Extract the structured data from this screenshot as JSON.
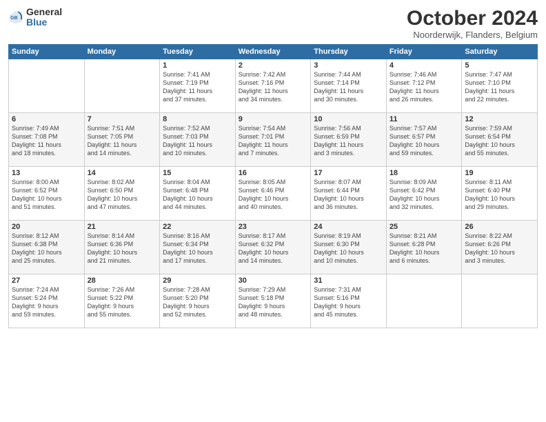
{
  "header": {
    "logo_general": "General",
    "logo_blue": "Blue",
    "month_title": "October 2024",
    "location": "Noorderwijk, Flanders, Belgium"
  },
  "days_of_week": [
    "Sunday",
    "Monday",
    "Tuesday",
    "Wednesday",
    "Thursday",
    "Friday",
    "Saturday"
  ],
  "weeks": [
    [
      {
        "day": "",
        "info": ""
      },
      {
        "day": "",
        "info": ""
      },
      {
        "day": "1",
        "info": "Sunrise: 7:41 AM\nSunset: 7:19 PM\nDaylight: 11 hours\nand 37 minutes."
      },
      {
        "day": "2",
        "info": "Sunrise: 7:42 AM\nSunset: 7:16 PM\nDaylight: 11 hours\nand 34 minutes."
      },
      {
        "day": "3",
        "info": "Sunrise: 7:44 AM\nSunset: 7:14 PM\nDaylight: 11 hours\nand 30 minutes."
      },
      {
        "day": "4",
        "info": "Sunrise: 7:46 AM\nSunset: 7:12 PM\nDaylight: 11 hours\nand 26 minutes."
      },
      {
        "day": "5",
        "info": "Sunrise: 7:47 AM\nSunset: 7:10 PM\nDaylight: 11 hours\nand 22 minutes."
      }
    ],
    [
      {
        "day": "6",
        "info": "Sunrise: 7:49 AM\nSunset: 7:08 PM\nDaylight: 11 hours\nand 18 minutes."
      },
      {
        "day": "7",
        "info": "Sunrise: 7:51 AM\nSunset: 7:05 PM\nDaylight: 11 hours\nand 14 minutes."
      },
      {
        "day": "8",
        "info": "Sunrise: 7:52 AM\nSunset: 7:03 PM\nDaylight: 11 hours\nand 10 minutes."
      },
      {
        "day": "9",
        "info": "Sunrise: 7:54 AM\nSunset: 7:01 PM\nDaylight: 11 hours\nand 7 minutes."
      },
      {
        "day": "10",
        "info": "Sunrise: 7:56 AM\nSunset: 6:59 PM\nDaylight: 11 hours\nand 3 minutes."
      },
      {
        "day": "11",
        "info": "Sunrise: 7:57 AM\nSunset: 6:57 PM\nDaylight: 10 hours\nand 59 minutes."
      },
      {
        "day": "12",
        "info": "Sunrise: 7:59 AM\nSunset: 6:54 PM\nDaylight: 10 hours\nand 55 minutes."
      }
    ],
    [
      {
        "day": "13",
        "info": "Sunrise: 8:00 AM\nSunset: 6:52 PM\nDaylight: 10 hours\nand 51 minutes."
      },
      {
        "day": "14",
        "info": "Sunrise: 8:02 AM\nSunset: 6:50 PM\nDaylight: 10 hours\nand 47 minutes."
      },
      {
        "day": "15",
        "info": "Sunrise: 8:04 AM\nSunset: 6:48 PM\nDaylight: 10 hours\nand 44 minutes."
      },
      {
        "day": "16",
        "info": "Sunrise: 8:05 AM\nSunset: 6:46 PM\nDaylight: 10 hours\nand 40 minutes."
      },
      {
        "day": "17",
        "info": "Sunrise: 8:07 AM\nSunset: 6:44 PM\nDaylight: 10 hours\nand 36 minutes."
      },
      {
        "day": "18",
        "info": "Sunrise: 8:09 AM\nSunset: 6:42 PM\nDaylight: 10 hours\nand 32 minutes."
      },
      {
        "day": "19",
        "info": "Sunrise: 8:11 AM\nSunset: 6:40 PM\nDaylight: 10 hours\nand 29 minutes."
      }
    ],
    [
      {
        "day": "20",
        "info": "Sunrise: 8:12 AM\nSunset: 6:38 PM\nDaylight: 10 hours\nand 25 minutes."
      },
      {
        "day": "21",
        "info": "Sunrise: 8:14 AM\nSunset: 6:36 PM\nDaylight: 10 hours\nand 21 minutes."
      },
      {
        "day": "22",
        "info": "Sunrise: 8:16 AM\nSunset: 6:34 PM\nDaylight: 10 hours\nand 17 minutes."
      },
      {
        "day": "23",
        "info": "Sunrise: 8:17 AM\nSunset: 6:32 PM\nDaylight: 10 hours\nand 14 minutes."
      },
      {
        "day": "24",
        "info": "Sunrise: 8:19 AM\nSunset: 6:30 PM\nDaylight: 10 hours\nand 10 minutes."
      },
      {
        "day": "25",
        "info": "Sunrise: 8:21 AM\nSunset: 6:28 PM\nDaylight: 10 hours\nand 6 minutes."
      },
      {
        "day": "26",
        "info": "Sunrise: 8:22 AM\nSunset: 6:26 PM\nDaylight: 10 hours\nand 3 minutes."
      }
    ],
    [
      {
        "day": "27",
        "info": "Sunrise: 7:24 AM\nSunset: 5:24 PM\nDaylight: 9 hours\nand 59 minutes."
      },
      {
        "day": "28",
        "info": "Sunrise: 7:26 AM\nSunset: 5:22 PM\nDaylight: 9 hours\nand 55 minutes."
      },
      {
        "day": "29",
        "info": "Sunrise: 7:28 AM\nSunset: 5:20 PM\nDaylight: 9 hours\nand 52 minutes."
      },
      {
        "day": "30",
        "info": "Sunrise: 7:29 AM\nSunset: 5:18 PM\nDaylight: 9 hours\nand 48 minutes."
      },
      {
        "day": "31",
        "info": "Sunrise: 7:31 AM\nSunset: 5:16 PM\nDaylight: 9 hours\nand 45 minutes."
      },
      {
        "day": "",
        "info": ""
      },
      {
        "day": "",
        "info": ""
      }
    ]
  ]
}
